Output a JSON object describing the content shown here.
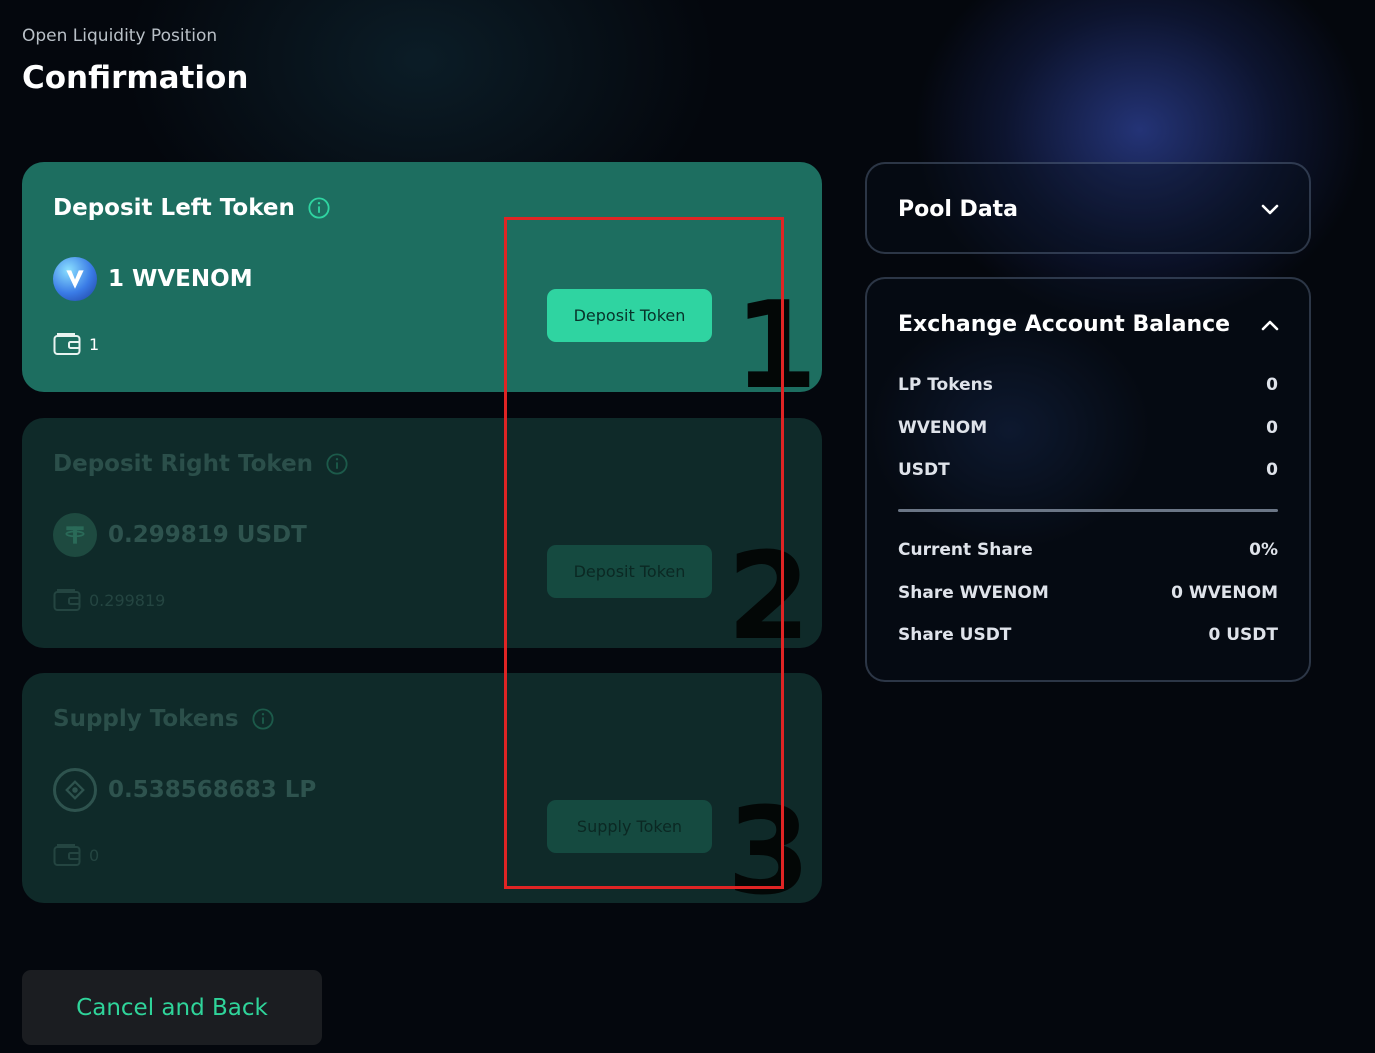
{
  "header": {
    "subtitle": "Open Liquidity Position",
    "title": "Confirmation"
  },
  "steps": [
    {
      "title": "Deposit Left Token",
      "amount": "1 WVENOM",
      "token_icon": "venom-v-icon",
      "wallet_balance": "1",
      "button_label": "Deposit Token",
      "marker": "1",
      "state": "active"
    },
    {
      "title": "Deposit Right Token",
      "amount": "0.299819 USDT",
      "token_icon": "tether-t-icon",
      "wallet_balance": "0.299819",
      "button_label": "Deposit Token",
      "marker": "2",
      "state": "disabled"
    },
    {
      "title": "Supply Tokens",
      "amount": "0.538568683 LP",
      "token_icon": "lp-token-icon",
      "wallet_balance": "0",
      "button_label": "Supply Token",
      "marker": "3",
      "state": "disabled"
    }
  ],
  "pool_data": {
    "title": "Pool Data",
    "expanded": false
  },
  "exchange_balance": {
    "title": "Exchange Account Balance",
    "expanded": true,
    "balances": [
      {
        "label": "LP Tokens",
        "value": "0"
      },
      {
        "label": "WVENOM",
        "value": "0"
      },
      {
        "label": "USDT",
        "value": "0"
      }
    ],
    "shares": [
      {
        "label": "Current Share",
        "value": "0%"
      },
      {
        "label": "Share WVENOM",
        "value": "0 WVENOM"
      },
      {
        "label": "Share USDT",
        "value": "0 USDT"
      }
    ]
  },
  "footer": {
    "cancel_label": "Cancel and Back"
  },
  "colors": {
    "accent": "#2fd4a1",
    "active_card": "#1d6e60",
    "disabled_card": "#0f2a29",
    "highlight_box": "#e02424",
    "background": "#04070d"
  }
}
